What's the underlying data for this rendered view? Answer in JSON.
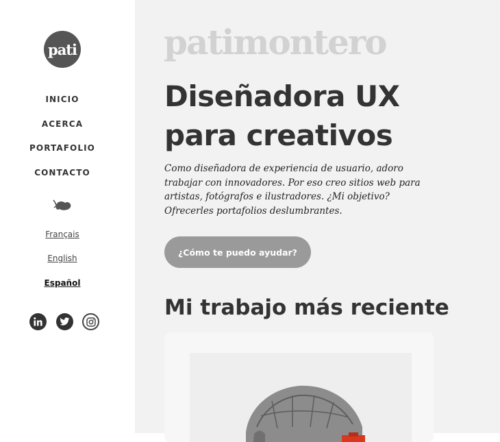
{
  "sidebar": {
    "logo_text": "pati",
    "nav": [
      {
        "label": "INICIO"
      },
      {
        "label": "ACERCA"
      },
      {
        "label": "PORTAFOLIO"
      },
      {
        "label": "CONTACTO"
      }
    ],
    "languages": [
      {
        "label": "Français"
      },
      {
        "label": "English"
      },
      {
        "label": "Español",
        "active": true
      }
    ],
    "social_icons": [
      "linkedin-icon",
      "twitter-icon",
      "instagram-icon"
    ]
  },
  "main": {
    "brand": "patimontero",
    "headline_line1": "Diseñadora UX",
    "headline_line2": "para creativos",
    "intro": "Como diseñadora de experiencia de usuario, adoro trabajar con innovadores. Por eso creo sitios web para artistas, fotógrafos e ilustradores. ¿Mi objetivo? Ofrecerles portafolios deslumbrantes.",
    "cta_label": "¿Cómo te puedo ayudar?",
    "section_title": "Mi trabajo más reciente"
  },
  "colors": {
    "sidebar_bg": "#ffffff",
    "main_bg": "#f2f2f2",
    "heading_text": "#333333",
    "brand_text": "#d2d2d2",
    "button_bg": "#9a9a9a",
    "logo_bg": "#555555",
    "accent_red": "#d9381e"
  }
}
